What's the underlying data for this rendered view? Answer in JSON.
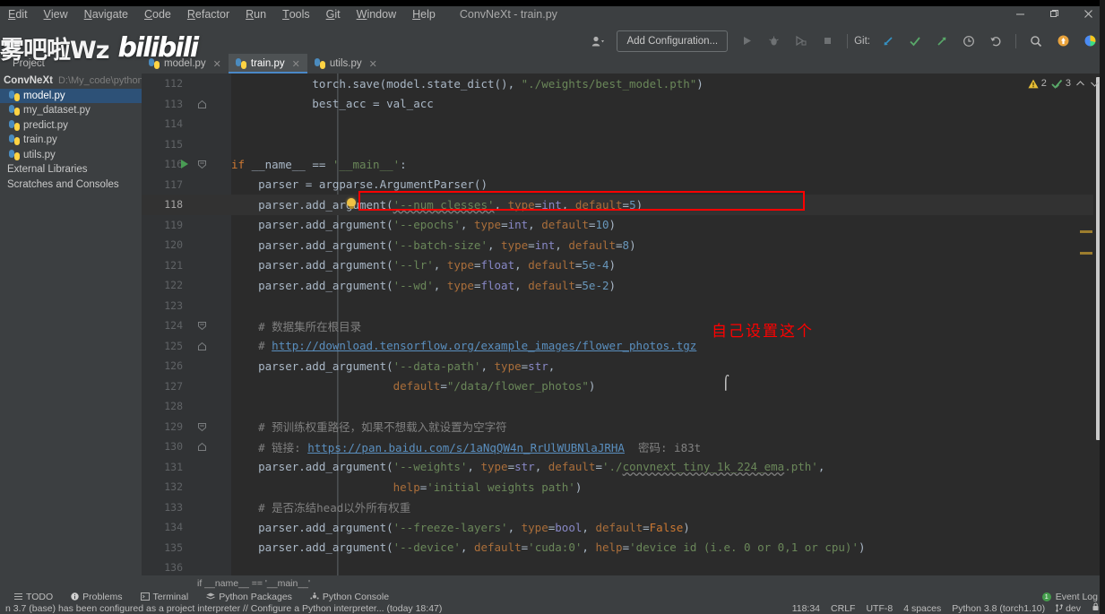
{
  "window": {
    "title": "ConvNeXt - train.py",
    "controls": {
      "minimize": "—",
      "maximize": "❐",
      "close": "✕"
    }
  },
  "menubar": {
    "items": [
      {
        "label": "Edit",
        "mnemonic": "E",
        "rest": "dit"
      },
      {
        "label": "View",
        "mnemonic": "V",
        "rest": "iew"
      },
      {
        "label": "Navigate",
        "mnemonic": "N",
        "rest": "avigate"
      },
      {
        "label": "Code",
        "mnemonic": "C",
        "rest": "ode"
      },
      {
        "label": "Refactor",
        "mnemonic": "R",
        "rest": "efactor"
      },
      {
        "label": "Run",
        "mnemonic": "R",
        "rest": "un"
      },
      {
        "label": "Tools",
        "mnemonic": "T",
        "rest": "ools"
      },
      {
        "label": "Git",
        "mnemonic": "G",
        "rest": "it"
      },
      {
        "label": "Window",
        "mnemonic": "W",
        "rest": "indow"
      },
      {
        "label": "Help",
        "mnemonic": "H",
        "rest": "elp"
      }
    ]
  },
  "toolbar": {
    "config_label": "Add Configuration...",
    "git_label": "Git:",
    "icons": {
      "user": "user-icon",
      "run": "run-icon",
      "debug": "debug-icon",
      "coverage": "coverage-icon",
      "stop": "stop-icon",
      "update": "git-update-icon",
      "commit": "git-commit-icon",
      "push": "git-push-icon",
      "history": "history-icon",
      "undo": "undo-icon",
      "search": "search-icon",
      "updates": "updates-icon",
      "ide": "ide-icon"
    }
  },
  "project": {
    "tab_label": "Project",
    "tree": [
      {
        "label": "ConvNeXt",
        "path": "D:\\My_code\\pythonP",
        "type": "root",
        "selected": false
      },
      {
        "label": "model.py",
        "type": "python",
        "selected": true
      },
      {
        "label": "my_dataset.py",
        "type": "python",
        "selected": false
      },
      {
        "label": "predict.py",
        "type": "python",
        "selected": false
      },
      {
        "label": "train.py",
        "type": "python",
        "selected": false
      },
      {
        "label": "utils.py",
        "type": "python",
        "selected": false
      },
      {
        "label": "External Libraries",
        "type": "plain",
        "selected": false
      },
      {
        "label": "Scratches and Consoles",
        "type": "plain",
        "selected": false
      }
    ]
  },
  "tabs": [
    {
      "label": "model.py",
      "active": false
    },
    {
      "label": "train.py",
      "active": true
    },
    {
      "label": "utils.py",
      "active": false
    }
  ],
  "editor": {
    "warnings": "2",
    "checks": "3",
    "breadcrumb": "if __name__ == '__main__'",
    "annotation": "自己设置这个",
    "lines": [
      {
        "n": "112",
        "html": "            <span class='fn'>torch</span>.save(model.state_dict(), <span class='str'>\"./weights/best_model.pth\"</span>)"
      },
      {
        "n": "113",
        "html": "            best_acc = val_acc"
      },
      {
        "n": "114",
        "html": ""
      },
      {
        "n": "115",
        "html": ""
      },
      {
        "n": "116",
        "html": "<span class='kw'>if</span> __name__ == <span class='str'>'__main__'</span>:"
      },
      {
        "n": "117",
        "html": "    parser = argparse.ArgumentParser()"
      },
      {
        "n": "118",
        "html": "    parser.add_argument(<span class='str typo'>'--num_clesses'</span>, <span class='kwarg'>type</span>=<span class='bi'>int</span>, <span class='kwarg'>default</span>=<span class='num'>5</span>)"
      },
      {
        "n": "119",
        "html": "    parser.add_argument(<span class='str'>'--epochs'</span>, <span class='kwarg'>type</span>=<span class='bi'>int</span>, <span class='kwarg'>default</span>=<span class='num'>10</span>)"
      },
      {
        "n": "120",
        "html": "    parser.add_argument(<span class='str'>'--batch-size'</span>, <span class='kwarg'>type</span>=<span class='bi'>int</span>, <span class='kwarg'>default</span>=<span class='num'>8</span>)"
      },
      {
        "n": "121",
        "html": "    parser.add_argument(<span class='str'>'--lr'</span>, <span class='kwarg'>type</span>=<span class='bi'>float</span>, <span class='kwarg'>default</span>=<span class='num'>5e-4</span>)"
      },
      {
        "n": "122",
        "html": "    parser.add_argument(<span class='str'>'--wd'</span>, <span class='kwarg'>type</span>=<span class='bi'>float</span>, <span class='kwarg'>default</span>=<span class='num'>5e-2</span>)"
      },
      {
        "n": "123",
        "html": ""
      },
      {
        "n": "124",
        "html": "    <span class='cmt'># 数据集所在根目录</span>"
      },
      {
        "n": "125",
        "html": "    <span class='cmt'># <span class='link'>http://download.tensorflow.org/example_images/flower_photos.tgz</span></span>"
      },
      {
        "n": "126",
        "html": "    parser.add_argument(<span class='str'>'--data-path'</span>, <span class='kwarg'>type</span>=<span class='bi'>str</span>,"
      },
      {
        "n": "127",
        "html": "                        <span class='kwarg'>default</span>=<span class='str'>\"/data/flower_photos\"</span>)"
      },
      {
        "n": "128",
        "html": ""
      },
      {
        "n": "129",
        "html": "    <span class='cmt'># 预训练权重路径，如果不想载入就设置为空字符</span>"
      },
      {
        "n": "130",
        "html": "    <span class='cmt'># 链接: <span class='link'>https://pan.baidu.com/s/1aNqQW4n_RrUlWUBNlaJRHA</span>  密码: i83t</span>"
      },
      {
        "n": "131",
        "html": "    parser.add_argument(<span class='str'>'--weights'</span>, <span class='kwarg'>type</span>=<span class='bi'>str</span>, <span class='kwarg'>default</span>=<span class='str'>'./<span class='typo'>convnext_tiny_1k_224_ema</span>.pth'</span>,"
      },
      {
        "n": "132",
        "html": "                        <span class='kwarg'>help</span>=<span class='str'>'initial weights path'</span>)"
      },
      {
        "n": "133",
        "html": "    <span class='cmt'># 是否冻结head以外所有权重</span>"
      },
      {
        "n": "134",
        "html": "    parser.add_argument(<span class='str'>'--freeze-layers'</span>, <span class='kwarg'>type</span>=<span class='bi'>bool</span>, <span class='kwarg'>default</span>=<span class='kw'>False</span>)"
      },
      {
        "n": "135",
        "html": "    parser.add_argument(<span class='str'>'--device'</span>, <span class='kwarg'>default</span>=<span class='str'>'cuda:0'</span>, <span class='kwarg'>help</span>=<span class='str'>'device id (i.e. 0 or 0,1 or cpu)'</span>)"
      },
      {
        "n": "136",
        "html": ""
      }
    ]
  },
  "toolwindows": {
    "items": [
      {
        "label": "TODO",
        "icon": "todo-icon"
      },
      {
        "label": "Problems",
        "icon": "problems-icon"
      },
      {
        "label": "Terminal",
        "icon": "terminal-icon"
      },
      {
        "label": "Python Packages",
        "icon": "packages-icon"
      },
      {
        "label": "Python Console",
        "icon": "console-icon"
      }
    ],
    "event_log": "Event Log",
    "event_count": "1"
  },
  "statusbar": {
    "message": "n 3.7 (base) has been configured as a project interpreter // Configure a Python interpreter... (today 18:47)",
    "position": "118:34",
    "line_separator": "CRLF",
    "encoding": "UTF-8",
    "indent": "4 spaces",
    "interpreter": "Python 3.8 (torch1.10)",
    "branch": "dev",
    "lock": "lock-icon"
  },
  "watermark": {
    "cn_text": "雾吧啦Wz",
    "brand": "bilibili"
  },
  "colors": {
    "accent": "#4a88c7",
    "annotation_red": "#ff0000",
    "selection_blue": "#2d5177",
    "editor_bg": "#2b2b2b",
    "chrome_bg": "#3c3f41"
  }
}
